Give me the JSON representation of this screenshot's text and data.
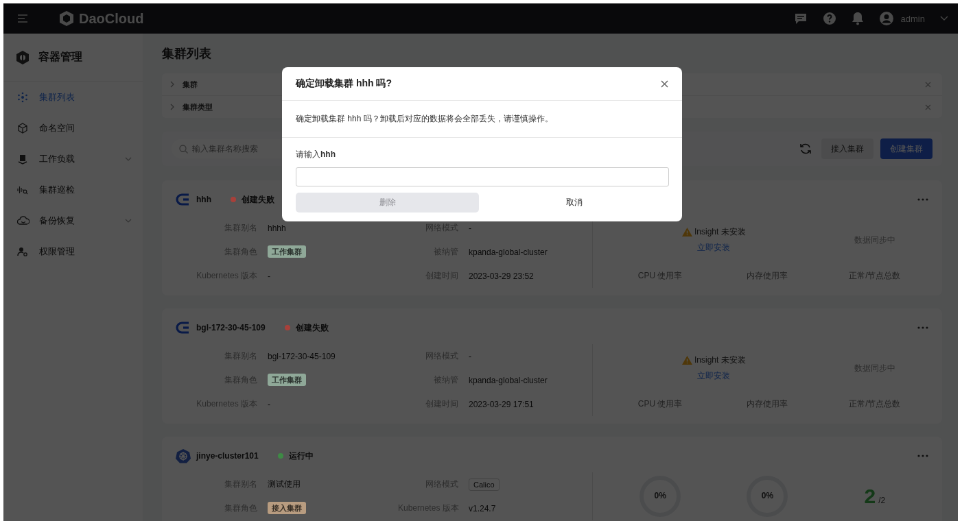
{
  "topbar": {
    "brand": "DaoCloud",
    "user": "admin"
  },
  "sidebar": {
    "title": "容器管理",
    "items": [
      {
        "label": "集群列表",
        "selected": true,
        "has_submenu": false
      },
      {
        "label": "命名空间",
        "selected": false,
        "has_submenu": false
      },
      {
        "label": "工作负载",
        "selected": false,
        "has_submenu": true
      },
      {
        "label": "集群巡检",
        "selected": false,
        "has_submenu": false
      },
      {
        "label": "备份恢复",
        "selected": false,
        "has_submenu": true
      },
      {
        "label": "权限管理",
        "selected": false,
        "has_submenu": false
      }
    ]
  },
  "page": {
    "title": "集群列表"
  },
  "filters": [
    {
      "label": "集群"
    },
    {
      "label": "集群类型"
    }
  ],
  "toolbar": {
    "search_placeholder": "输入集群名称搜索",
    "buttons": [
      {
        "label": "接入集群",
        "kind": "default"
      },
      {
        "label": "创建集群",
        "kind": "primary"
      }
    ]
  },
  "clusters": [
    {
      "name": "hhh",
      "kind": "failed",
      "status": "创建失败",
      "color": "#a8403a",
      "fields": [
        {
          "label": "集群别名",
          "value": "hhhh",
          "kind": "text"
        },
        {
          "label": "网络模式",
          "value": "-",
          "kind": "text"
        },
        {
          "label": "集群角色",
          "value": "工作集群",
          "kind": "tag",
          "color": "#8fa898"
        },
        {
          "label": "被纳管",
          "value": "kpanda-global-cluster",
          "kind": "text"
        },
        {
          "label": "Kubernetes 版本",
          "value": "-",
          "kind": "text"
        },
        {
          "label": "创建时间",
          "value": "2023-03-29 23:52",
          "kind": "text"
        }
      ],
      "insight": "Insight 未安装",
      "install_link": "立即安装",
      "sync": "数据同步中",
      "metric_labels": [
        "CPU 使用率",
        "内存使用率",
        "正常/节点总数"
      ]
    },
    {
      "name": "bgl-172-30-45-109",
      "kind": "failed",
      "status": "创建失败",
      "color": "#a8403a",
      "fields": [
        {
          "label": "集群别名",
          "value": "bgl-172-30-45-109",
          "kind": "text"
        },
        {
          "label": "网络模式",
          "value": "-",
          "kind": "text"
        },
        {
          "label": "集群角色",
          "value": "工作集群",
          "kind": "tag",
          "color": "#8fa898"
        },
        {
          "label": "被纳管",
          "value": "kpanda-global-cluster",
          "kind": "text"
        },
        {
          "label": "Kubernetes 版本",
          "value": "-",
          "kind": "text"
        },
        {
          "label": "创建时间",
          "value": "2023-03-29 17:51",
          "kind": "text"
        }
      ],
      "insight": "Insight 未安装",
      "install_link": "立即安装",
      "sync": "数据同步中",
      "metric_labels": [
        "CPU 使用率",
        "内存使用率",
        "正常/节点总数"
      ]
    },
    {
      "name": "jinye-cluster101",
      "kind": "running",
      "status": "运行中",
      "color": "#3e8a45",
      "fields": [
        {
          "label": "集群别名",
          "value": "测试使用",
          "kind": "text"
        },
        {
          "label": "网络模式",
          "value": "Calico",
          "kind": "chip"
        },
        {
          "label": "集群角色",
          "value": "接入集群",
          "kind": "tag",
          "color": "#b89c80"
        },
        {
          "label": "Kubernetes 版本",
          "value": "v1.24.7",
          "kind": "text"
        }
      ],
      "gauges": [
        {
          "value": "0%",
          "level": 0
        },
        {
          "value": "0%",
          "level": 0
        }
      ],
      "nodes_ready": "2",
      "nodes_total": "/2"
    }
  ],
  "dialog": {
    "title": "确定卸载集群 hhh 吗?",
    "message": "确定卸载集群 hhh 吗？卸载后对应的数据将会全部丢失，请谨慎操作。",
    "input_label": "请输入**hhh**",
    "confirm": {
      "label": "删除",
      "disabled": true
    },
    "cancel": "取消"
  }
}
